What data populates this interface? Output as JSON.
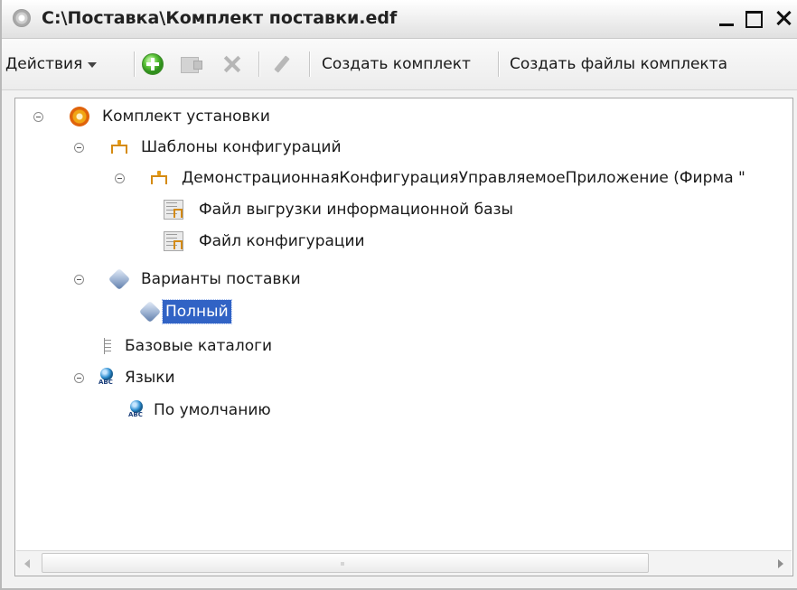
{
  "window": {
    "title": "C:\\Поставка\\Комплект поставки.edf",
    "icon": "app-circle-icon"
  },
  "toolbar": {
    "actions_label": "Действия",
    "buttons": [
      {
        "icon": "add-icon",
        "enabled": true
      },
      {
        "icon": "copy-icon",
        "enabled": false
      },
      {
        "icon": "delete-icon",
        "enabled": false
      },
      {
        "icon": "edit-icon",
        "enabled": false
      }
    ],
    "create_kit_label": "Создать комплект",
    "create_kit_files_label": "Создать файлы комплекта"
  },
  "tree": {
    "root": {
      "label": "Комплект установки",
      "icon": "kit-icon",
      "expanded": true
    },
    "templates": {
      "label": "Шаблоны конфигураций",
      "icon": "template-icon",
      "expanded": true
    },
    "config": {
      "label": "ДемонстрационнаяКонфигурацияУправляемоеПриложение (Фирма \"",
      "icon": "template-icon",
      "expanded": true
    },
    "infobase_file": {
      "label": "Файл выгрузки информационной базы",
      "icon": "file-icon"
    },
    "config_file": {
      "label": "Файл конфигурации",
      "icon": "file-icon"
    },
    "variants": {
      "label": "Варианты поставки",
      "icon": "variant-icon",
      "expanded": true
    },
    "full": {
      "label": "Полный",
      "icon": "variant-icon",
      "selected": true
    },
    "catalogs": {
      "label": "Базовые каталоги",
      "icon": "catalog-icon"
    },
    "languages": {
      "label": "Языки",
      "icon": "language-icon",
      "expanded": true
    },
    "default_lang": {
      "label": "По умолчанию",
      "icon": "language-icon"
    }
  },
  "colors": {
    "selection": "#3163c5",
    "accent_orange": "#e39a16"
  }
}
